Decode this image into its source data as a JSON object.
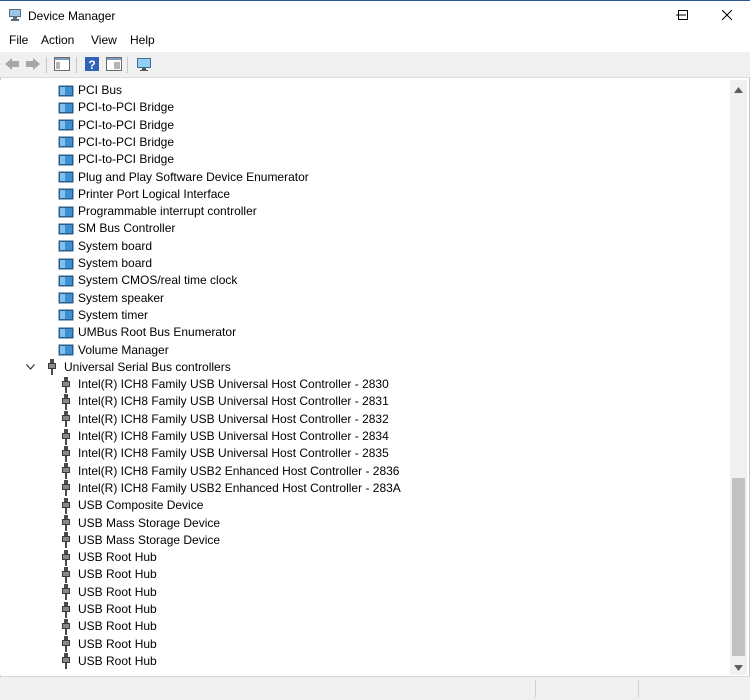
{
  "window": {
    "title": "Device Manager",
    "app_icon": "device-manager-icon",
    "controls": [
      "minimize-icon",
      "maximize-icon",
      "close-icon"
    ]
  },
  "menu": {
    "file": "File",
    "action": "Action",
    "view": "View",
    "help": "Help"
  },
  "toolbar": {
    "buttons": [
      "back-arrow-icon",
      "forward-arrow-icon",
      "properties-pane-icon",
      "help-icon",
      "update-driver-icon",
      "monitor-icon"
    ]
  },
  "tree": {
    "system_devices": [
      "PCI Bus",
      "PCI-to-PCI Bridge",
      "PCI-to-PCI Bridge",
      "PCI-to-PCI Bridge",
      "PCI-to-PCI Bridge",
      "Plug and Play Software Device Enumerator",
      "Printer Port Logical Interface",
      "Programmable interrupt controller",
      "SM Bus Controller",
      "System board",
      "System board",
      "System CMOS/real time clock",
      "System speaker",
      "System timer",
      "UMBus Root Bus Enumerator",
      "Volume Manager"
    ],
    "usb_category": "Universal Serial Bus controllers",
    "usb_expanded": true,
    "usb_devices": [
      "Intel(R) ICH8 Family USB Universal Host Controller - 2830",
      "Intel(R) ICH8 Family USB Universal Host Controller - 2831",
      "Intel(R) ICH8 Family USB Universal Host Controller - 2832",
      "Intel(R) ICH8 Family USB Universal Host Controller - 2834",
      "Intel(R) ICH8 Family USB Universal Host Controller - 2835",
      "Intel(R) ICH8 Family USB2 Enhanced Host Controller - 2836",
      "Intel(R) ICH8 Family USB2 Enhanced Host Controller - 283A",
      "USB Composite Device",
      "USB Mass Storage Device",
      "USB Mass Storage Device",
      "USB Root Hub",
      "USB Root Hub",
      "USB Root Hub",
      "USB Root Hub",
      "USB Root Hub",
      "USB Root Hub",
      "USB Root Hub"
    ]
  },
  "colors": {
    "title_border": "#2b579a",
    "system_icon": "#3c8fd0",
    "usb_icon": "#4a4a4a",
    "scrollbar_thumb": "#c2c2c2"
  }
}
